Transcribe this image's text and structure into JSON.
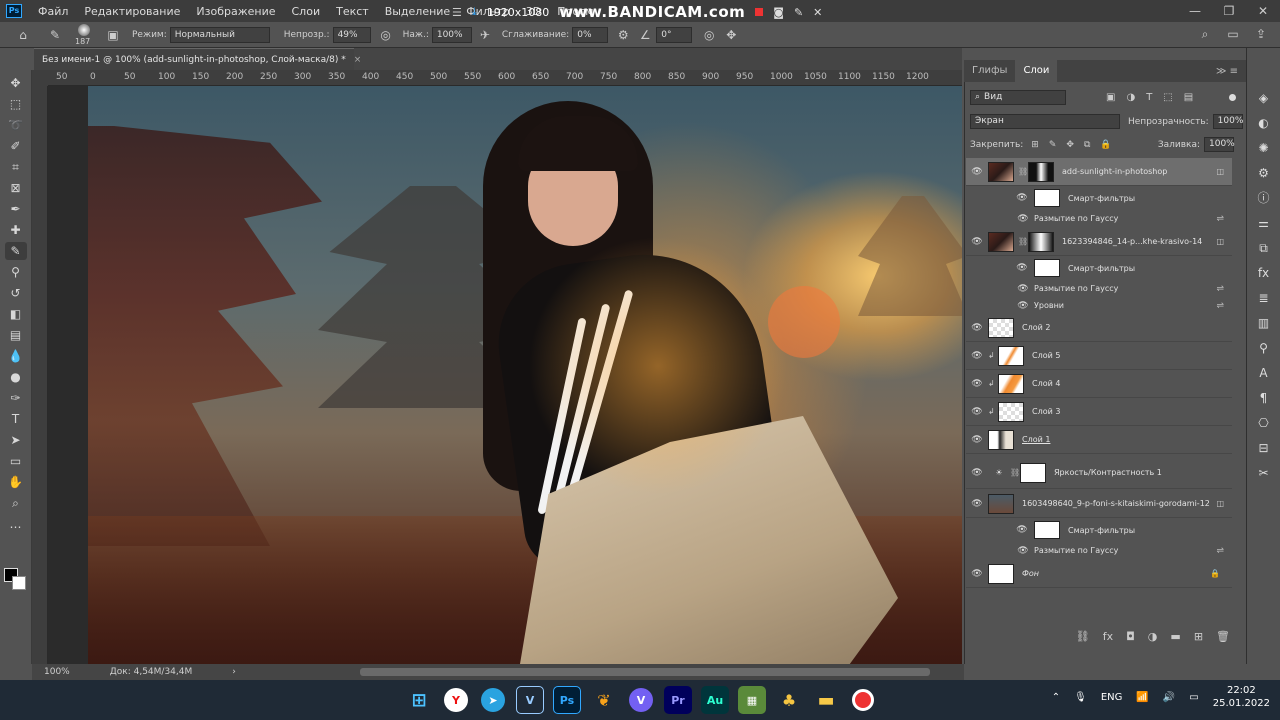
{
  "menubar": {
    "logo": "Ps",
    "items": [
      "Файл",
      "Редактирование",
      "Изображение",
      "Слои",
      "Текст",
      "Выделение",
      "Фильтр",
      "3D",
      "Просм"
    ],
    "recording_title": "1920x1080",
    "recording_brand": "www.BANDICAM.com",
    "window_controls": [
      "—",
      "❐",
      "✕"
    ]
  },
  "options": {
    "brush_size": "187",
    "mode_label": "Режим:",
    "mode_value": "Нормальный",
    "opacity_label": "Непрозр.:",
    "opacity_value": "49%",
    "pressure_label": "Наж.:",
    "pressure_value": "100%",
    "smoothing_label": "Сглаживание:",
    "smoothing_value": "0%",
    "angle_value": "0°"
  },
  "document": {
    "tab_title": "Без имени-1 @ 100% (add-sunlight-in-photoshop, Слой-маска/8) *",
    "close": "×",
    "ruler_ticks": [
      "50",
      "0",
      "50",
      "100",
      "150",
      "200",
      "250",
      "300",
      "350",
      "400",
      "450",
      "500",
      "550",
      "600",
      "650",
      "700",
      "750",
      "800",
      "850",
      "900",
      "950",
      "1000",
      "1050",
      "1100",
      "1150",
      "1200"
    ],
    "zoom": "100%",
    "doc_info": "Док: 4,54M/34,4M"
  },
  "panel": {
    "tabs": [
      "Глифы",
      "Слои"
    ],
    "active_tab": "Слои",
    "filter_kind": "Вид",
    "blend_mode": "Экран",
    "opacity_label": "Непрозрачность:",
    "opacity_value": "100%",
    "lock_label": "Закрепить:",
    "fill_label": "Заливка:",
    "fill_value": "100%"
  },
  "layers": {
    "l1": "add-sunlight-in-photoshop",
    "l1_sf": "Смарт-фильтры",
    "l1_f1": "Размытие по Гауссу",
    "l2": "1623394846_14-p...khe-krasivo-14",
    "l2_sf": "Смарт-фильтры",
    "l2_f1": "Размытие по Гауссу",
    "l2_f2": "Уровни",
    "l3": "Слой 2",
    "l4": "Слой 5",
    "l5": "Слой 4",
    "l6": "Слой 3",
    "l7": "Слой 1",
    "l8": "Яркость/Контрастность 1",
    "l9": "1603498640_9-p-foni-s-kitaiskimi-gorodami-12",
    "l9_sf": "Смарт-фильтры",
    "l9_f1": "Размытие по Гауссу",
    "l10": "Фон"
  },
  "taskbar": {
    "lang": "ENG",
    "time": "22:02",
    "date": "25.01.2022",
    "apps": [
      "windows-start",
      "yandex-browser",
      "telegram",
      "visual-studio",
      "photoshop",
      "fl-studio",
      "viber",
      "premiere-pro",
      "audition",
      "minecraft",
      "stardew",
      "file-explorer",
      "bandicam-record"
    ]
  },
  "colors": {
    "accent": "#31a8ff",
    "panel_bg": "#535353",
    "taskbar_bg": "#1f2a36",
    "selected_layer": "#6e6e6e"
  }
}
